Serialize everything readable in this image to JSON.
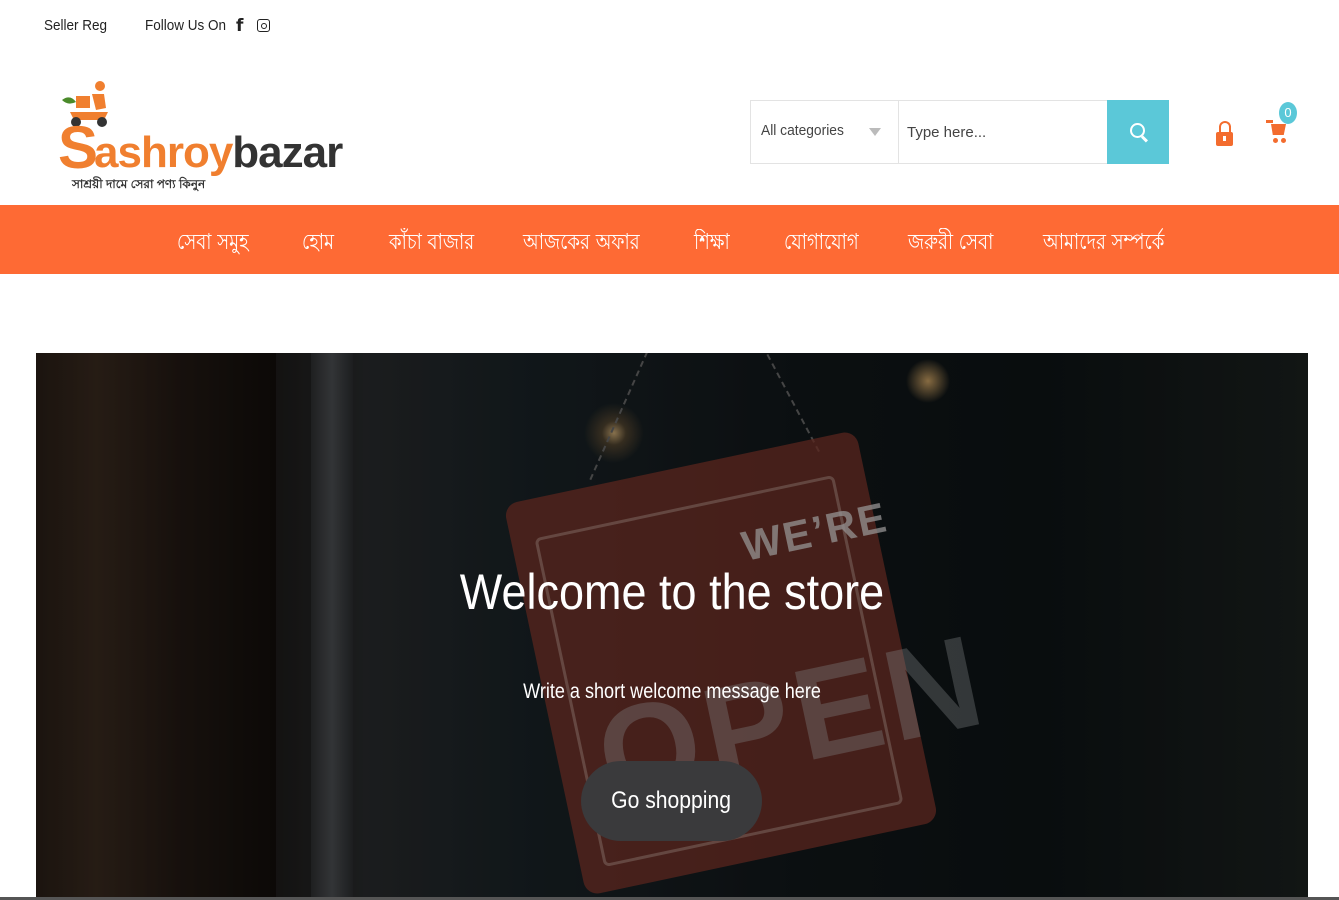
{
  "topbar": {
    "seller_reg": "Seller Reg",
    "follow_us": "Follow Us On",
    "facebook_icon": "facebook-icon",
    "instagram_icon": "instagram-icon"
  },
  "logo": {
    "first_letter": "S",
    "name_part1": "ashroy",
    "name_part2": "bazar",
    "tagline": "সাশ্রয়ী দামে সেরা পণ্য কিনুন"
  },
  "search": {
    "category": "All categories",
    "placeholder": "Type here..."
  },
  "cart": {
    "count": "0"
  },
  "nav": {
    "items": [
      {
        "label": "সেবা সমুহ"
      },
      {
        "label": "হোম"
      },
      {
        "label": "কাঁচা বাজার"
      },
      {
        "label": "আজকের অফার"
      },
      {
        "label": "শিক্ষা"
      },
      {
        "label": "যোগাযোগ"
      },
      {
        "label": "জরুরী সেবা"
      },
      {
        "label": "আমাদের সম্পর্কে"
      }
    ]
  },
  "hero": {
    "title": "Welcome to the store",
    "subtitle": "Write a short welcome message here",
    "button": "Go shopping",
    "sign_top": "WE’RE",
    "sign_main": "OPEN"
  },
  "colors": {
    "nav_bg": "#fe6a34",
    "accent_cyan": "#5bc8d8",
    "brand_orange": "#f07f2f",
    "button_dark": "#3a3a3c"
  }
}
